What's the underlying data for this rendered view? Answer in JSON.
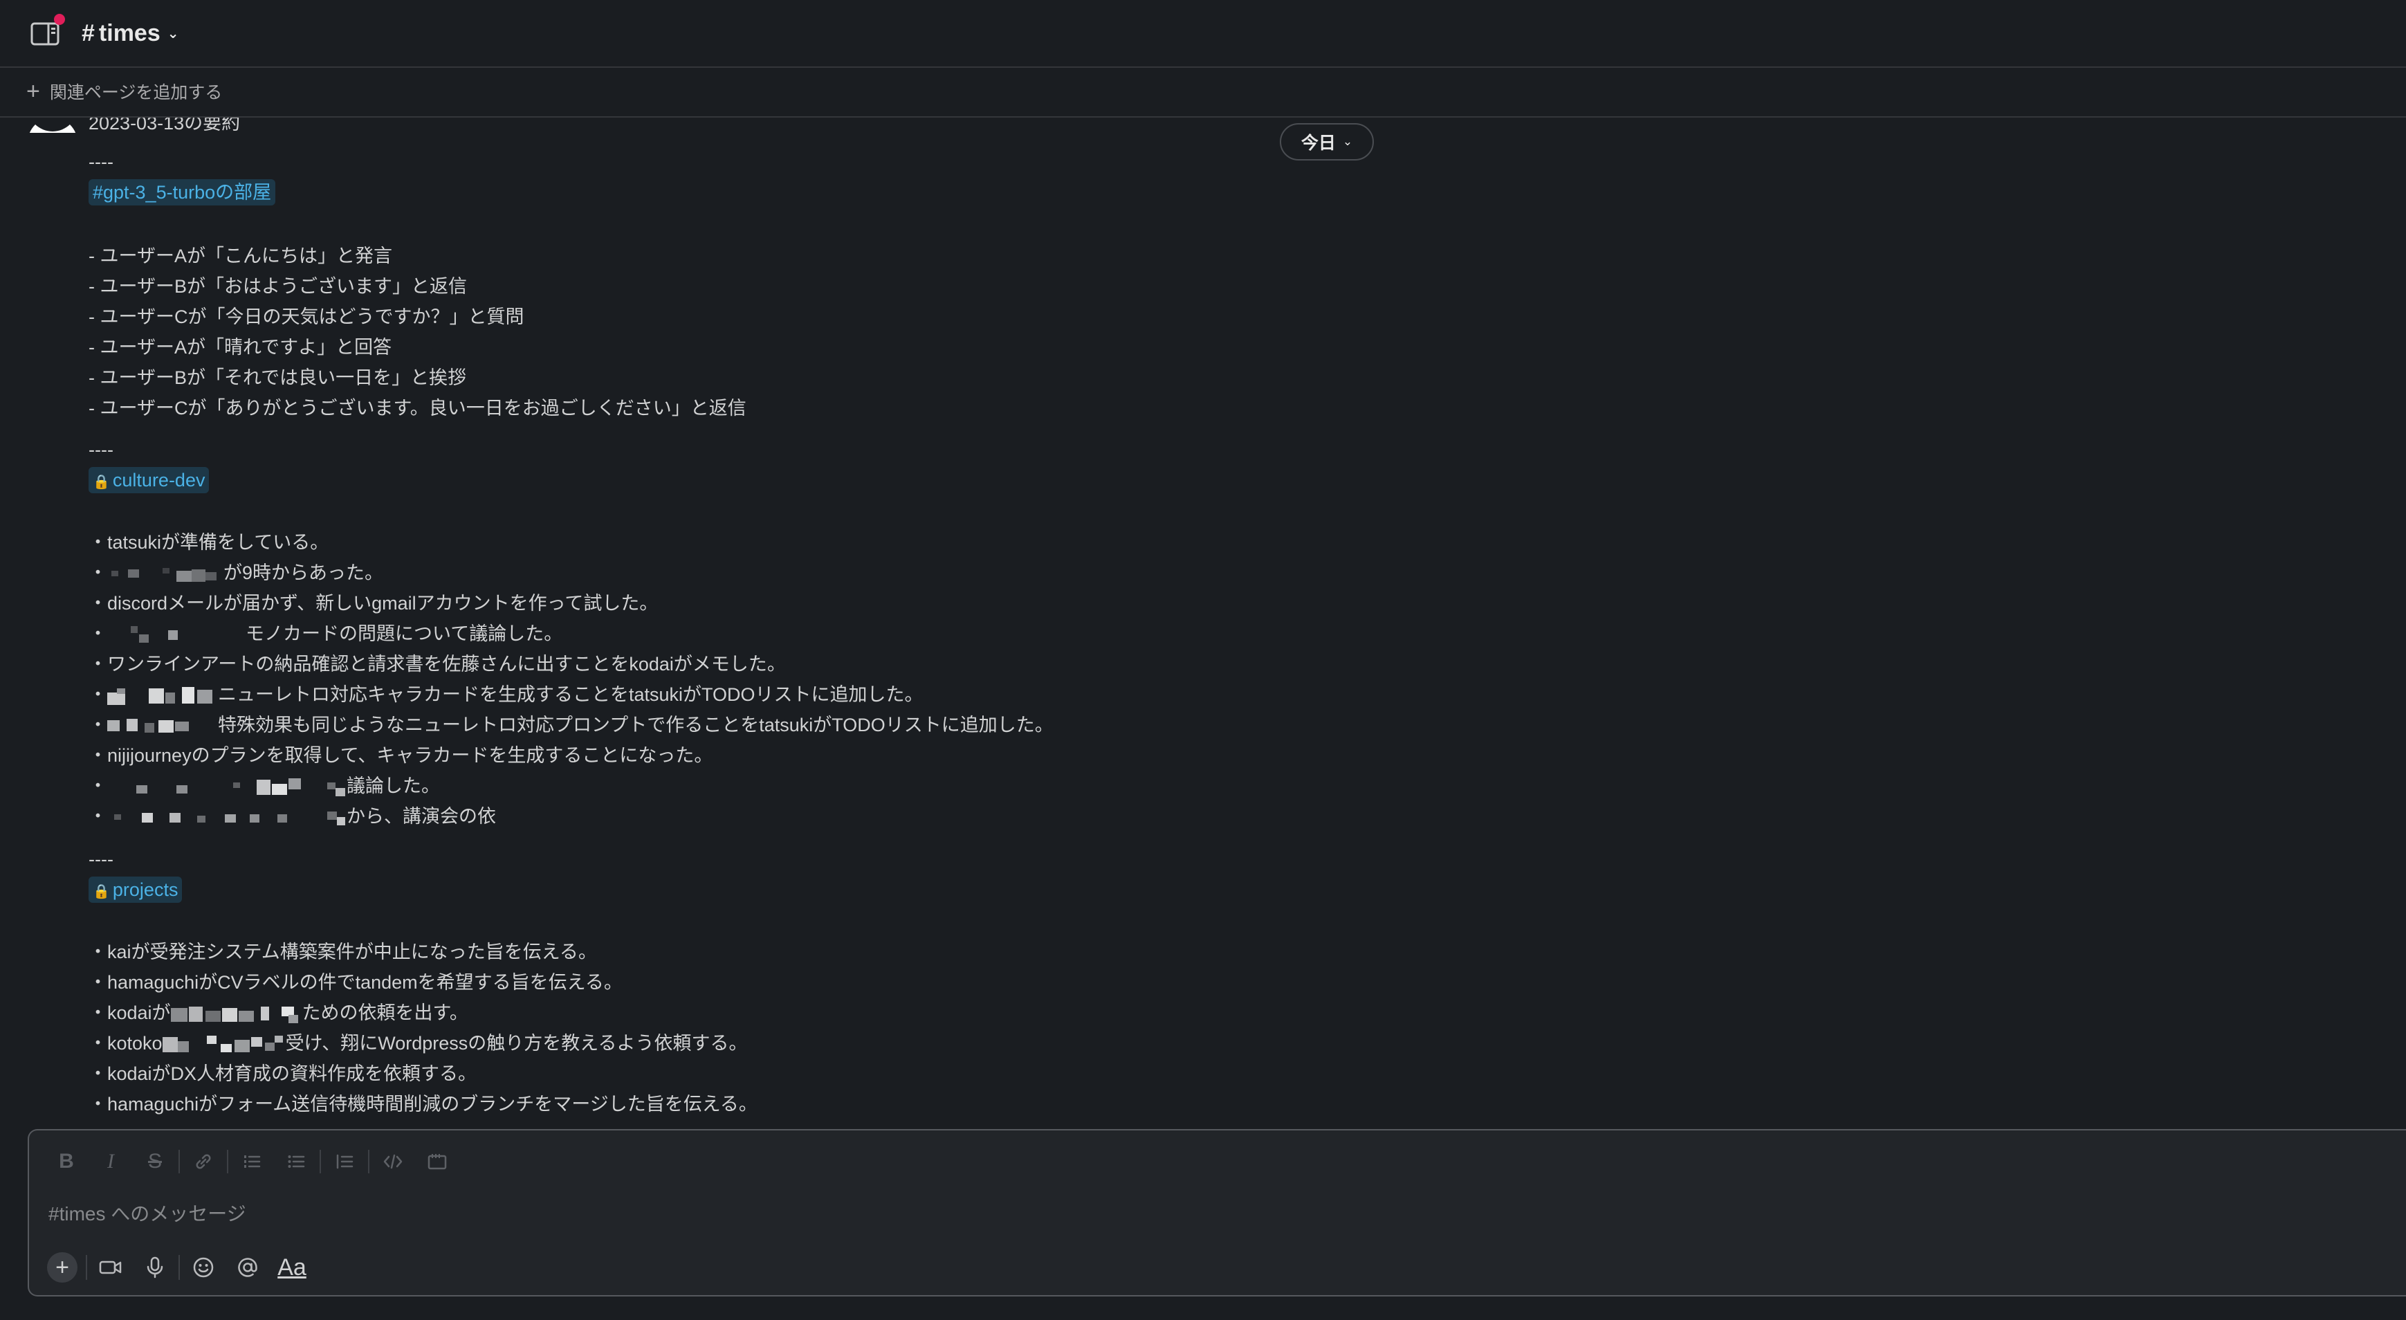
{
  "header": {
    "channel_hash": "#",
    "channel_name": "times"
  },
  "bookmarks": {
    "add_label": "関連ページを追加する"
  },
  "date_divider": {
    "label": "今日"
  },
  "message": {
    "title": "2023-03-13の要約",
    "sections": [
      {
        "separator": "----",
        "channel": "#gpt-3_5-turboの部屋",
        "private": false,
        "items": [
          "- ユーザーAが「こんにちは」と発言",
          "- ユーザーBが「おはようございます」と返信",
          "- ユーザーCが「今日の天気はどうですか？」と質問",
          "- ユーザーAが「晴れですよ」と回答",
          "- ユーザーBが「それでは良い一日を」と挨拶",
          "- ユーザーCが「ありがとうございます。良い一日をお過ごしください」と返信"
        ]
      },
      {
        "separator": "----",
        "channel": "culture-dev",
        "private": true,
        "items": [
          "・tatsukiが準備をしている。",
          "が9時からあった。",
          "・discordメールが届かず、新しいgmailアカウントを作って試した。",
          "モノカードの問題について議論した。",
          "・ワンラインアートの納品確認と請求書を佐藤さんに出すことをkodaiがメモした。",
          "ニューレトロ対応キャラカードを生成することをtatsukiがTODOリストに追加した。",
          "特殊効果も同じようなニューレトロ対応プロンプトで作ることをtatsukiがTODOリストに追加した。",
          "・nijijourneyのプランを取得して、キャラカードを生成することになった。",
          "議論した。",
          "から、講演会の依"
        ]
      },
      {
        "separator": "----",
        "channel": "projects",
        "private": true,
        "items": [
          "・kaiが受発注システム構築案件が中止になった旨を伝える。",
          "・hamaguchiがCVラベルの件でtandemを希望する旨を伝える。",
          "ための依頼を出す。",
          "受け、翔にWordpressの触り方を教えるよう依頼する。",
          "・kodaiがDX人材育成の資料作成を依頼する。",
          "・hamaguchiがフォーム送信待機時間削減のブランチをマージした旨を伝える。"
        ]
      }
    ],
    "fragments": {
      "bullet": "・",
      "kodai_prefix": "・kodaiが",
      "kotoko_prefix": "・kotoko"
    }
  },
  "composer": {
    "placeholder": "#times へのメッセージ",
    "format_tools": [
      "bold-icon",
      "italic-icon",
      "strikethrough-icon",
      "link-icon",
      "ordered-list-icon",
      "bulleted-list-icon",
      "blockquote-icon",
      "code-icon",
      "code-block-icon"
    ],
    "action_tools": [
      "plus-icon",
      "video-icon",
      "microphone-icon",
      "emoji-icon",
      "mention-icon",
      "format-text-icon"
    ],
    "format_label": "Aa"
  },
  "colors": {
    "background": "#1a1d21",
    "link": "#4bb2e6",
    "link_bg": "#1d3848",
    "notification": "#e01e5a"
  }
}
